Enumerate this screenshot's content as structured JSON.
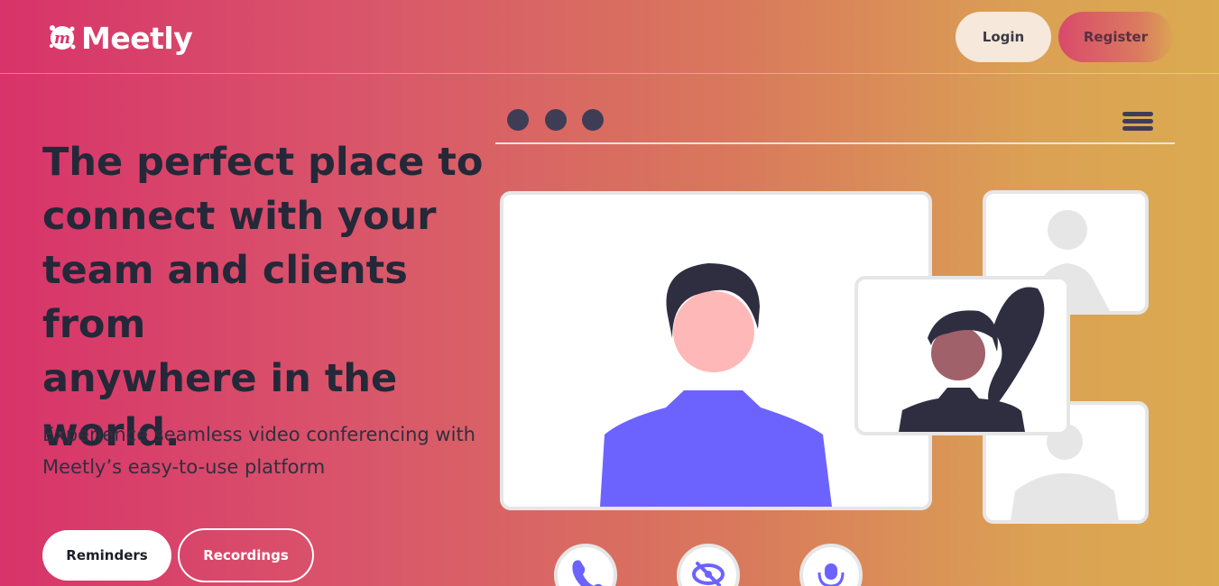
{
  "nav": {
    "brand_name": "Meetly",
    "login_label": "Login",
    "register_label": "Register"
  },
  "hero": {
    "title_lines": [
      "The perfect place to",
      "connect with your",
      "team and clients from",
      "anywhere in the",
      "world."
    ],
    "subtitle_lines": [
      "Experience seamless video conferencing with",
      "Meetly’s easy-to-use platform"
    ],
    "primary_button": "Reminders",
    "secondary_button": "Recordings"
  },
  "illustration": {
    "window_dots": [
      "dot",
      "dot",
      "dot"
    ],
    "menu_icon": "hamburger-menu-icon",
    "controls": [
      "phone-icon",
      "eye-off-icon",
      "microphone-icon"
    ]
  },
  "colors": {
    "accent_purple": "#6c63ff",
    "dark": "#2f2e41",
    "skin": "#ffb8b8",
    "placeholder_gray": "#e6e6e6"
  }
}
